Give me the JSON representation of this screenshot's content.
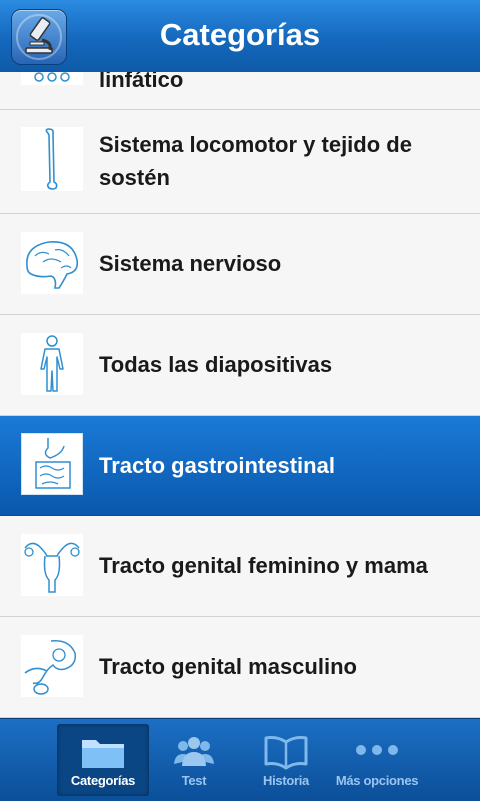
{
  "header": {
    "title": "Categorías",
    "app_icon": "microscope-icon"
  },
  "categories": [
    {
      "label": "linfático",
      "icon": "lymph-nodes-icon"
    },
    {
      "label": "Sistema locomotor y tejido de sostén",
      "icon": "bone-icon"
    },
    {
      "label": "Sistema nervioso",
      "icon": "brain-icon"
    },
    {
      "label": "Todas las diapositivas",
      "icon": "human-body-icon"
    },
    {
      "label": "Tracto gastrointestinal",
      "icon": "intestine-icon",
      "selected": true
    },
    {
      "label": "Tracto genital feminino y mama",
      "icon": "uterus-icon"
    },
    {
      "label": "Tracto genital masculino",
      "icon": "male-genital-icon"
    }
  ],
  "tabs": [
    {
      "label": "Categorías",
      "icon": "folder-icon",
      "active": true
    },
    {
      "label": "Test",
      "icon": "people-icon"
    },
    {
      "label": "Historia",
      "icon": "book-icon"
    },
    {
      "label": "Más opciones",
      "icon": "more-dots-icon"
    }
  ],
  "colors": {
    "accent": "#1468bd",
    "selected_row": "#0a58ad",
    "illustration_stroke": "#2f8fd0"
  }
}
